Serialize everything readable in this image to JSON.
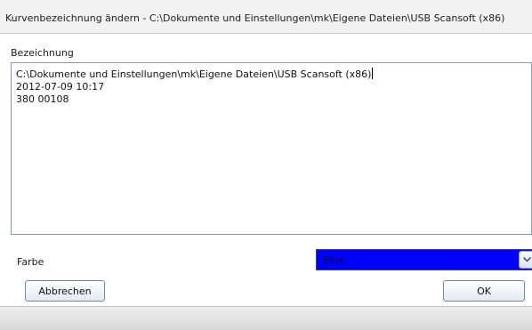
{
  "window": {
    "title": "Kurvenbezeichnung ändern - C:\\Dokumente und Einstellungen\\mk\\Eigene Dateien\\USB Scansoft (x86)"
  },
  "bezeichnung": {
    "label": "Bezeichnung",
    "lines": [
      "C:\\Dokumente und Einstellungen\\mk\\Eigene Dateien\\USB Scansoft (x86)",
      "2012-07-09 10:17",
      "380 00108"
    ]
  },
  "farbe": {
    "label": "Farbe",
    "selected": "Blue",
    "swatch_color": "#0000ff"
  },
  "buttons": {
    "cancel": "Abbrechen",
    "ok": "OK"
  },
  "icons": {
    "dropdown": "chevron-down-icon"
  }
}
